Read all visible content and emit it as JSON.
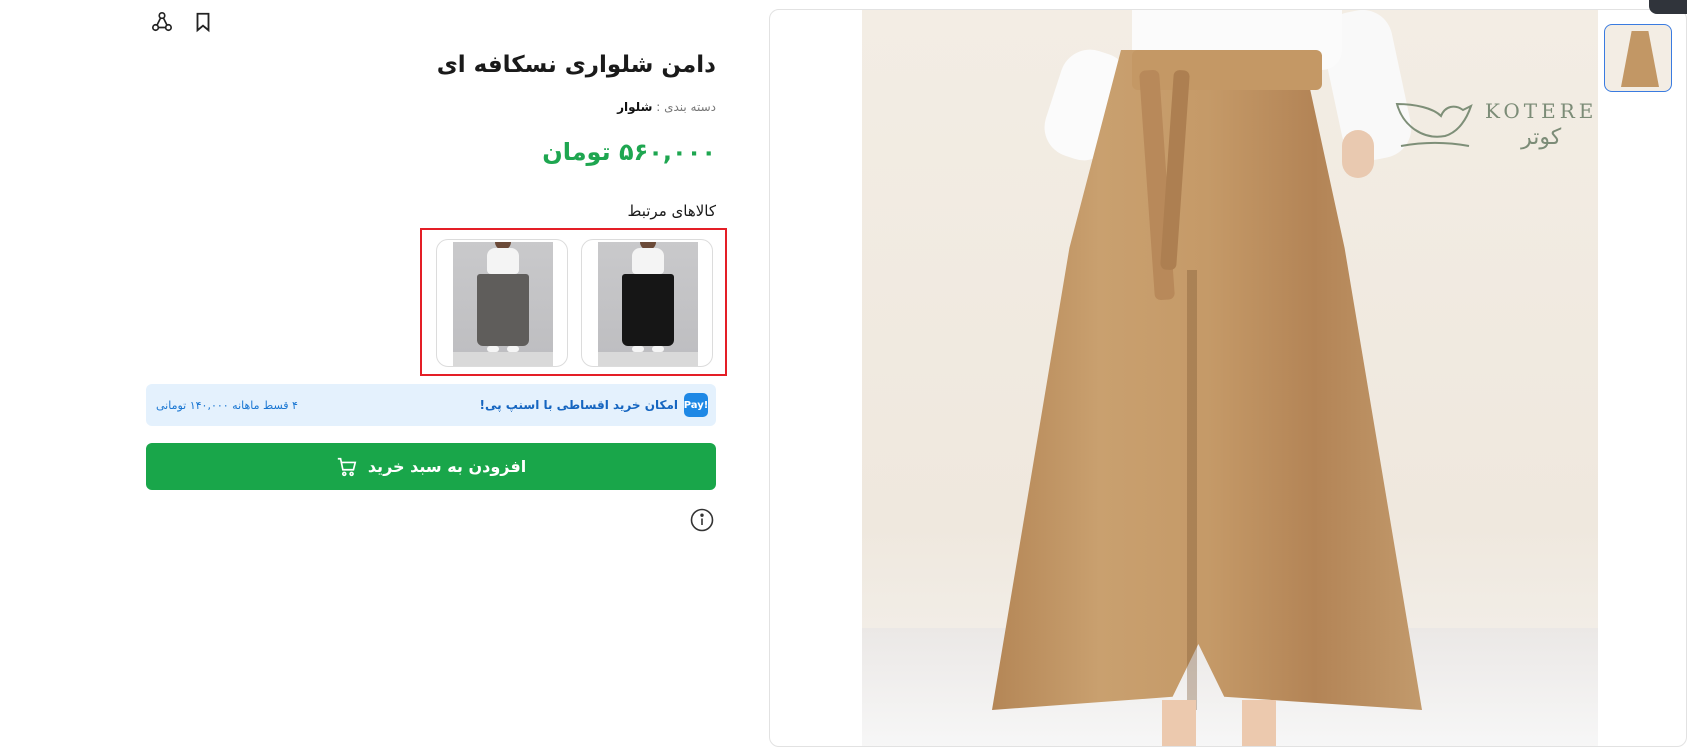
{
  "product": {
    "title": "دامن شلواری نسکافه ای",
    "category_label": "دسته بندی :",
    "category_value": "شلوار",
    "price": "۵۶۰,۰۰۰ تومان"
  },
  "related": {
    "title": "کالاهای مرتبط",
    "items": [
      {
        "color": "#161616",
        "icon": "black-pants-thumbnail"
      },
      {
        "color": "#5f5d5b",
        "icon": "gray-pants-thumbnail"
      }
    ]
  },
  "snapp_pay": {
    "logo": "Pay!",
    "message": "امکان خرید اقساطی با اسنپ پی!",
    "installment": "۴ قسط ماهانه ۱۴۰,۰۰۰ تومانی"
  },
  "actions": {
    "add_to_cart": "افزودن به سبد خرید",
    "icons": [
      "share-icon",
      "bookmark-icon",
      "cart-icon",
      "info-icon"
    ]
  },
  "gallery": {
    "brand_latin": "KOTERE",
    "brand_fa": "کوتر"
  },
  "colors": {
    "price": "#1ea650",
    "cart_button": "#19a64a",
    "highlight_border": "#e41e26",
    "pay_banner_bg": "#e4f1fd",
    "thumb_active_border": "#3a7be0"
  }
}
